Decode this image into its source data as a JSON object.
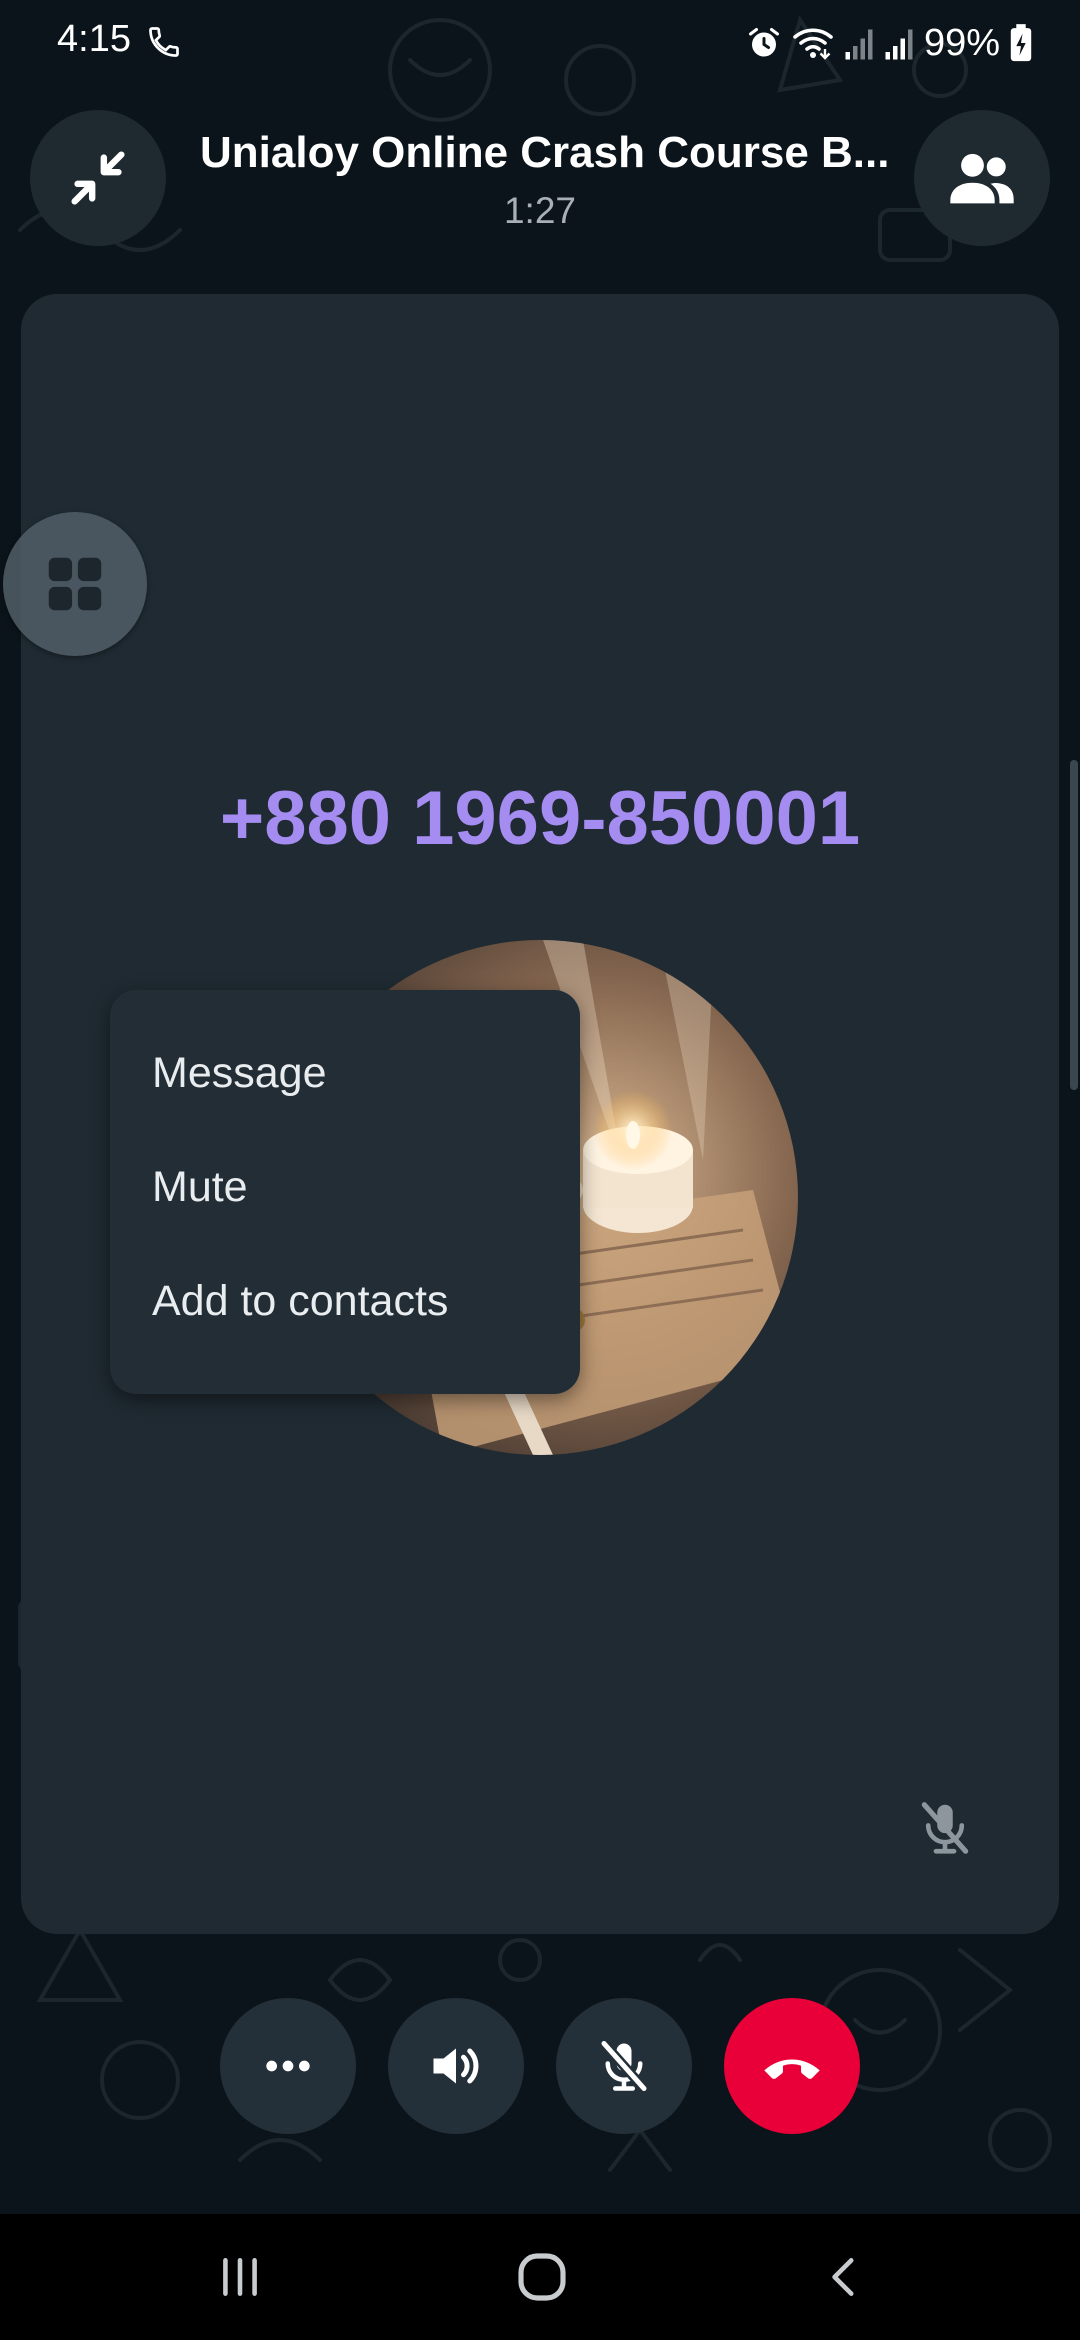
{
  "status_bar": {
    "time": "4:15",
    "battery_percent": "99%",
    "icons": [
      "phone-call-icon",
      "alarm-icon",
      "wifi-icon",
      "signal-icon",
      "signal-icon",
      "battery-charging-icon"
    ]
  },
  "header": {
    "title": "Unialoy Online Crash Course B...",
    "duration": "1:27",
    "left_icon": "minimize-icon",
    "right_icon": "participants-icon"
  },
  "main": {
    "phone_number": "+880 1969-850001",
    "grid_icon": "grid-view-icon",
    "muted_icon": "mic-off-icon"
  },
  "popup_menu": {
    "items": [
      {
        "label": "Message"
      },
      {
        "label": "Mute"
      },
      {
        "label": "Add to contacts"
      }
    ]
  },
  "controls": {
    "more_icon": "more-icon",
    "speaker_icon": "speaker-icon",
    "mic_icon": "mic-off-icon",
    "end_call_icon": "end-call-icon"
  },
  "nav": {
    "recent_icon": "recent-apps-icon",
    "home_icon": "home-icon",
    "back_icon": "back-icon"
  },
  "colors": {
    "background": "#0b141a",
    "card": "#1f2a32",
    "phone_number": "#a58cf0",
    "end_call": "#ea0038",
    "menu": "#222d35"
  }
}
